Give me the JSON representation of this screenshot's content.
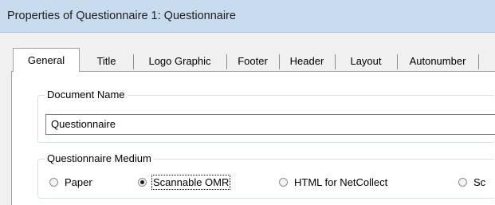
{
  "window": {
    "title": "Properties of Questionnaire 1: Questionnaire"
  },
  "tabs": [
    {
      "label": "General",
      "active": true
    },
    {
      "label": "Title"
    },
    {
      "label": "Logo Graphic"
    },
    {
      "label": "Footer"
    },
    {
      "label": "Header"
    },
    {
      "label": "Layout"
    },
    {
      "label": "Autonumber"
    }
  ],
  "document_name": {
    "legend": "Document Name",
    "value": "Questionnaire"
  },
  "medium": {
    "legend": "Questionnaire Medium",
    "options": [
      {
        "label": "Paper",
        "checked": false
      },
      {
        "label": "Scannable OMR",
        "checked": true
      },
      {
        "label": "HTML for NetCollect",
        "checked": false
      },
      {
        "label": "Sc",
        "checked": false
      }
    ]
  },
  "colors": {
    "titlebar": "#c9dbef",
    "panel": "#ffffff",
    "window": "#f0f0f0"
  }
}
